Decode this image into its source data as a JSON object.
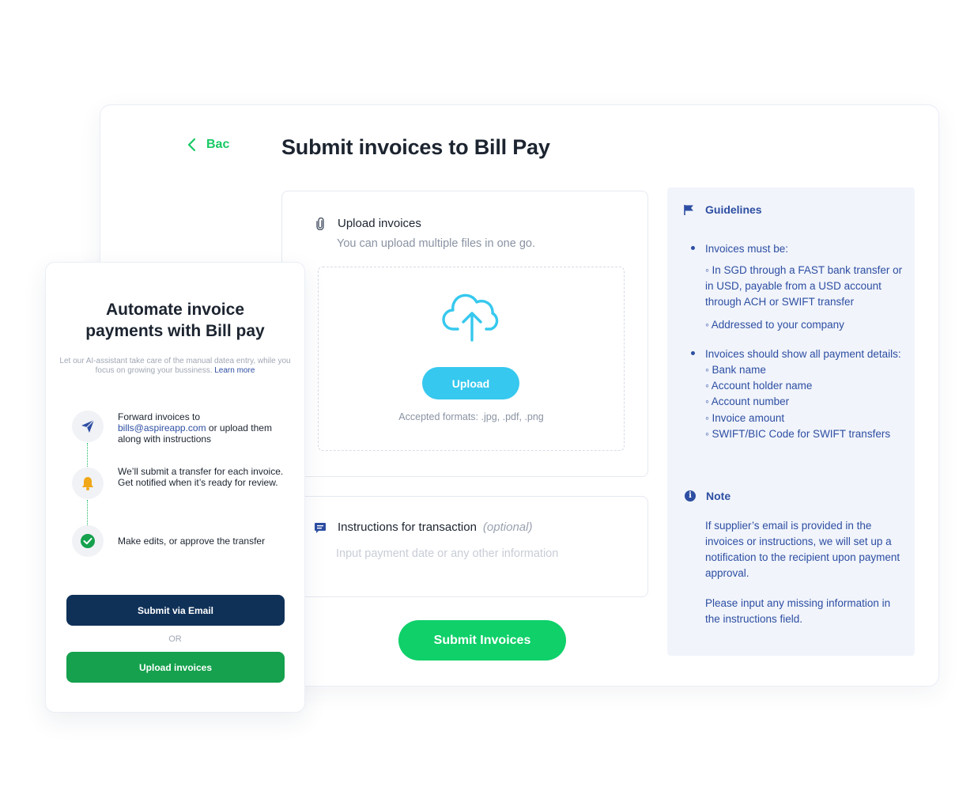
{
  "main": {
    "back_label": "Bac",
    "title": "Submit invoices to Bill Pay",
    "upload": {
      "title": "Upload invoices",
      "subtitle": "You can upload multiple files in one go.",
      "button_label": "Upload",
      "formats": "Accepted formats: .jpg, .pdf, .png"
    },
    "instructions": {
      "title": "Instructions for transaction",
      "optional": "(optional)",
      "placeholder": "Input payment date or any other information",
      "value": ""
    },
    "submit_label": "Submit Invoices"
  },
  "guidelines": {
    "title": "Guidelines",
    "bullet1": "Invoices must be:",
    "bullet1_sub1": "◦ In SGD through a FAST bank transfer or in USD, payable from a USD account through ACH or SWIFT transfer",
    "bullet1_sub2": "◦ Addressed to your company",
    "bullet2": "Invoices should show all payment details:",
    "bullet2_items": [
      "◦ Bank name",
      "◦ Account holder name",
      "◦ Account number",
      "◦ Invoice amount",
      "◦ SWIFT/BIC Code for SWIFT transfers"
    ],
    "note_title": "Note",
    "note_p1": "If supplier’s email is provided in the invoices or instructions, we will set up a notification to the recipient upon payment approval.",
    "note_p2": "Please input any missing information in the instructions field."
  },
  "promo": {
    "title": "Automate invoice payments with Bill pay",
    "description": "Let our AI-assistant take care of the manual datea entry, while you focus on growing your bussiness.",
    "learn_more": "Learn more",
    "step1_pre": "Forward invoices to",
    "step1_email": "bills@aspireapp.com",
    "step1_post": "or upload them along with instructions",
    "step2": "We’ll submit a transfer for each invoice. Get notified when it’s ready for review.",
    "step3": "Make edits, or approve the transfer",
    "email_button": "Submit via Email",
    "or": "OR",
    "upload_button": "Upload invoices"
  },
  "colors": {
    "brand_green": "#0fd069",
    "upload_blue": "#36c8ee",
    "navy": "#0f3158",
    "link_blue": "#2d4ea2",
    "guidelines_bg": "#f1f4fb"
  },
  "icons": [
    "chevron-left-icon",
    "paperclip-icon",
    "cloud-upload-icon",
    "message-icon",
    "flag-icon",
    "info-icon",
    "send-icon",
    "bell-icon",
    "check-circle-icon"
  ]
}
